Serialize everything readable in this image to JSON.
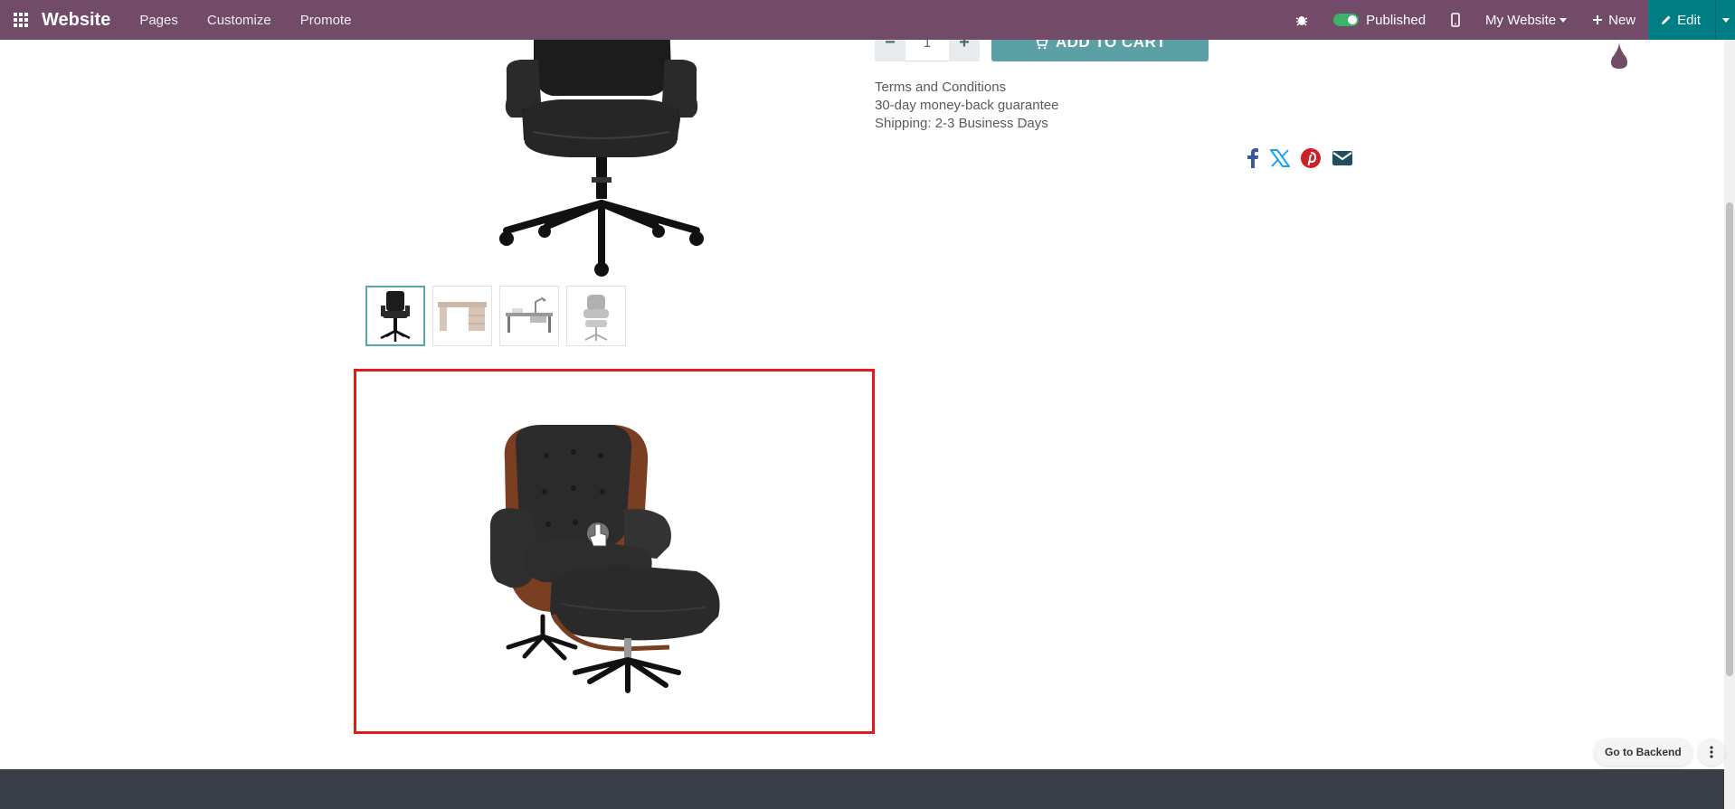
{
  "colors": {
    "brand": "#714b67",
    "edit": "#017e84",
    "cart": "#5aa0a4",
    "highlight": "#e31a1a",
    "footer": "#3a3e47"
  },
  "navbar": {
    "app_name": "Website",
    "menu": [
      "Pages",
      "Customize",
      "Promote"
    ],
    "debug_icon": "bug-icon",
    "published_label": "Published",
    "mobile_icon": "mobile-icon",
    "website_label": "My Website",
    "new_label": "New",
    "edit_label": "Edit"
  },
  "product": {
    "quantity": "1",
    "add_to_cart_label": "ADD TO CART",
    "terms_label": "Terms and Conditions",
    "guarantee_label": "30-day money-back guarantee",
    "shipping_label": "Shipping: 2-3 Business Days",
    "thumbnails": [
      {
        "name": "office-chair",
        "active": true
      },
      {
        "name": "desk-wood",
        "active": false
      },
      {
        "name": "desk-lamp",
        "active": false
      },
      {
        "name": "lounge-chair",
        "active": false
      }
    ],
    "share_icons": [
      "facebook-icon",
      "x-icon",
      "pinterest-icon",
      "email-icon"
    ]
  },
  "backend": {
    "label": "Go to Backend"
  }
}
